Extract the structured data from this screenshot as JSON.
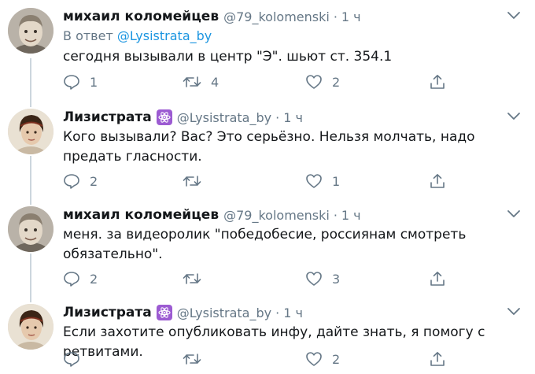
{
  "colors": {
    "text_primary": "#14171a",
    "text_secondary": "#657786",
    "link": "#1b95e0",
    "badge": "#9c5bd2",
    "icon": "#657786",
    "thread_line": "#ccd6dd"
  },
  "icons": {
    "reply": "speech-bubble",
    "retweet": "retweet-arrows",
    "like": "heart",
    "share": "share-upload",
    "more": "chevron-down",
    "badge": "atom"
  },
  "tweets": [
    {
      "name": "михаил коломейцев",
      "handle": "@79_kolomenski",
      "dot": "·",
      "time": "1 ч",
      "reply_prefix": "В ответ",
      "reply_mention": "@Lysistrata_by",
      "text": "сегодня вызывали в центр \"Э\". шьют ст. 354.1",
      "counts": {
        "reply": "1",
        "retweet": "4",
        "like": "2"
      }
    },
    {
      "name": "Лизистрата",
      "handle": "@Lysistrata_by",
      "dot": "·",
      "time": "1 ч",
      "text": "Кого вызывали? Вас? Это серьёзно. Нельзя молчать, надо предать гласности.",
      "counts": {
        "reply": "2",
        "retweet": "",
        "like": "1"
      }
    },
    {
      "name": "михаил коломейцев",
      "handle": "@79_kolomenski",
      "dot": "·",
      "time": "1 ч",
      "text": "меня. за видеоролик \"победобесие, россиянам смотреть обязательно\".",
      "counts": {
        "reply": "2",
        "retweet": "",
        "like": "3"
      }
    },
    {
      "name": "Лизистрата",
      "handle": "@Lysistrata_by",
      "dot": "·",
      "time": "1 ч",
      "text": "Если захотите опубликовать инфу, дайте знать, я помогу с ретвитами.",
      "counts": {
        "reply": "",
        "retweet": "",
        "like": "2"
      }
    }
  ]
}
